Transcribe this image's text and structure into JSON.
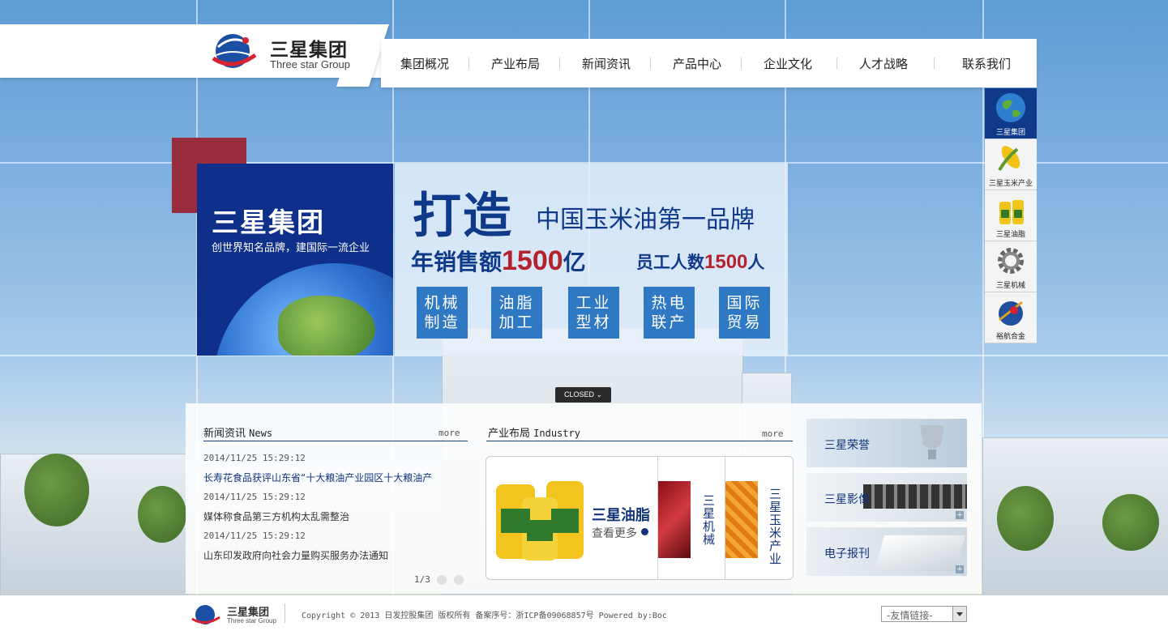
{
  "header": {
    "logo_cn": "三星集团",
    "logo_en": "Three star Group"
  },
  "nav": [
    "集团概况",
    "产业布局",
    "新闻资讯",
    "产品中心",
    "企业文化",
    "人才战略",
    "联系我们"
  ],
  "side_bar": [
    {
      "label": "三星集团",
      "icon": "globe-icon",
      "active": true
    },
    {
      "label": "三星玉米产业",
      "icon": "corn-icon",
      "active": false
    },
    {
      "label": "三星油脂",
      "icon": "oil-bottle-icon",
      "active": false
    },
    {
      "label": "三星机械",
      "icon": "gear-icon",
      "active": false
    },
    {
      "label": "裕航合金",
      "icon": "alloy-icon",
      "active": false
    }
  ],
  "banner": {
    "brand": "三星集团",
    "slogan": "创世界知名品牌，建国际一流企业",
    "headline": "打造",
    "headline_brand": "中国玉米油第一品牌",
    "sales_prefix": "年销售额",
    "sales_value": "1500",
    "sales_unit": "亿",
    "staff_prefix": "员工人数",
    "staff_value": "1500",
    "staff_unit": "人",
    "tiles": [
      {
        "line1": "机械",
        "line2": "制造"
      },
      {
        "line1": "油脂",
        "line2": "加工"
      },
      {
        "line1": "工业",
        "line2": "型材"
      },
      {
        "line1": "热电",
        "line2": "联产"
      },
      {
        "line1": "国际",
        "line2": "贸易"
      }
    ]
  },
  "closed_button": "CLOSED",
  "news": {
    "title_cn": "新闻资讯",
    "title_en": "News",
    "more": "more",
    "items": [
      {
        "date": "2014/11/25 15:29:12",
        "title": "长寿花食品获评山东省“十大粮油产业园区十大粮油产",
        "highlight": true
      },
      {
        "date": "2014/11/25 15:29:12",
        "title": "媒体称食品第三方机构太乱需整治",
        "highlight": false
      },
      {
        "date": "2014/11/25 15:29:12",
        "title": "山东印发政府向社会力量购买服务办法通知",
        "highlight": false
      }
    ],
    "pager": "1/3"
  },
  "industry": {
    "title_cn": "产业布局",
    "title_en": "Industry",
    "more": "more",
    "featured": "三星油脂",
    "featured_more": "查看更多",
    "vertical": [
      "三星机械",
      "三星玉米产业"
    ]
  },
  "promos": [
    "三星荣誉",
    "三星影像",
    "电子报刊"
  ],
  "footer": {
    "logo_cn": "三星集团",
    "logo_en": "Three star Group",
    "copyright": "Copyright © 2013 日发控股集团 版权所有 备案序号：浙ICP备09068857号 Powered by:Boc",
    "links_select": "-友情链接-"
  },
  "colors": {
    "brand_blue": "#0f3a8a",
    "accent_red": "#b3222d",
    "tile_blue": "#2f78c3"
  }
}
